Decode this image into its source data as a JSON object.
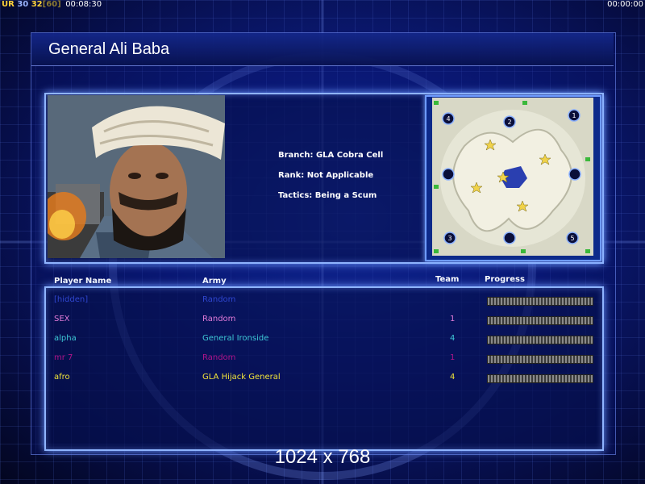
{
  "hud": {
    "fps_a": "UR",
    "fps_b": "30",
    "fps_c": "32",
    "fps_d": "[60]",
    "time_left": "00:08:30",
    "time_right": "00:00:00"
  },
  "general": {
    "title": "General Ali Baba",
    "branch": "Branch: GLA Cobra Cell",
    "rank": "Rank: Not Applicable",
    "tactics": "Tactics: Being a Scum"
  },
  "map": {
    "start_positions": [
      "1",
      "2",
      "3",
      "4",
      "5"
    ]
  },
  "table": {
    "headers": {
      "name": "Player Name",
      "army": "Army",
      "team": "Team",
      "progress": "Progress"
    },
    "rows": [
      {
        "name": "[hidden]",
        "army": "Random",
        "team": "",
        "color": "#2f46d0",
        "progress": 0
      },
      {
        "name": "SEX",
        "army": "Random",
        "team": "1",
        "color": "#e07ad8",
        "progress": 0
      },
      {
        "name": "alpha",
        "army": "General Ironside",
        "team": "4",
        "color": "#3ec8d6",
        "progress": 0
      },
      {
        "name": "mr 7",
        "army": "Random",
        "team": "1",
        "color": "#b0148a",
        "progress": 0
      },
      {
        "name": "afro",
        "army": "GLA Hijack General",
        "team": "4",
        "color": "#f0e33a",
        "progress": 0
      }
    ]
  },
  "footer": {
    "resolution": "1024 x 768"
  }
}
